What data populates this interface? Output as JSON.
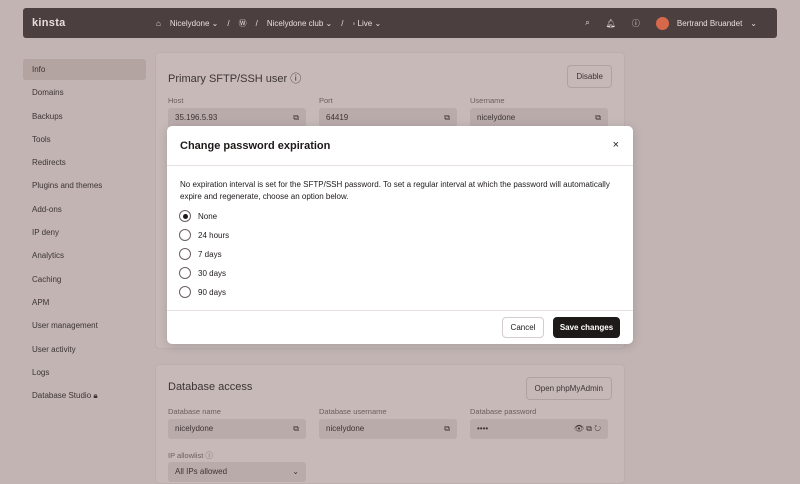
{
  "topbar": {
    "logo": "kinsta",
    "company": "Nicelydone",
    "site": "Nicelydone club",
    "env": "Live",
    "user": "Bertrand Bruandet"
  },
  "sidebar": [
    "Info",
    "Domains",
    "Backups",
    "Tools",
    "Redirects",
    "Plugins and themes",
    "Add-ons",
    "IP deny",
    "Analytics",
    "Caching",
    "APM",
    "User management",
    "User activity",
    "Logs",
    "Database Studio"
  ],
  "sftp": {
    "title": "Primary SFTP/SSH user",
    "disable": "Disable",
    "host_label": "Host",
    "host": "35.196.5.93",
    "port_label": "Port",
    "port": "64419",
    "user_label": "Username",
    "user": "nicelydone"
  },
  "db": {
    "title": "Database access",
    "open": "Open phpMyAdmin",
    "name_label": "Database name",
    "name": "nicelydone",
    "user_label": "Database username",
    "user": "nicelydone",
    "pw_label": "Database password",
    "pw": "••••",
    "ip_label": "IP allowlist",
    "ip": "All IPs allowed"
  },
  "modal": {
    "title": "Change password expiration",
    "close": "×",
    "description": "No expiration interval is set for the SFTP/SSH password. To set a regular interval at which the password will automatically expire and regenerate, choose an option below.",
    "options": [
      "None",
      "24 hours",
      "7 days",
      "30 days",
      "90 days"
    ],
    "selected": "None",
    "cancel": "Cancel",
    "save": "Save changes"
  }
}
